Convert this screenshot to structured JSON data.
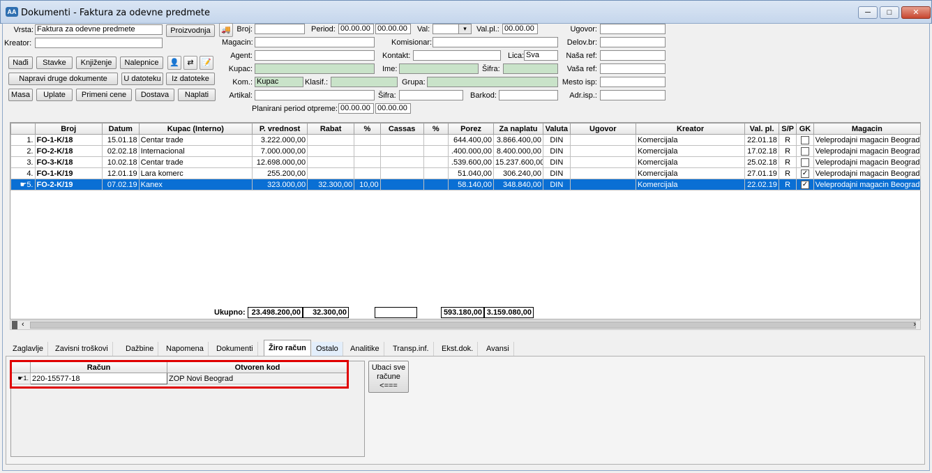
{
  "window": {
    "title": "Dokumenti - Faktura za odevne predmete",
    "icon": "app-icon",
    "min": "─",
    "max": "□",
    "close": "✕"
  },
  "form": {
    "vrsta_label": "Vrsta:",
    "vrsta": "Faktura za odevne predmete",
    "proizvodnja": "Proizvodnja",
    "kreator_label": "Kreator:",
    "kreator": "",
    "broj_label": "Broj:",
    "broj": "",
    "period_label": "Period:",
    "period_from": "00.00.00",
    "period_to": "00.00.00",
    "val_label": "Val:",
    "val": "",
    "valpl_label": "Val.pl.:",
    "valpl": "00.00.00",
    "ugovor_label": "Ugovor:",
    "ugovor": "",
    "magacin_label": "Magacin:",
    "magacin": "",
    "komisionar_label": "Komisionar:",
    "komisionar": "",
    "delovbr_label": "Delov.br:",
    "delovbr": "",
    "agent_label": "Agent:",
    "agent": "",
    "kontakt_label": "Kontakt:",
    "kontakt": "",
    "lica_label": "Lica:",
    "lica": "Sva",
    "nasaref_label": "Naša ref:",
    "nasaref": "",
    "kupac_label": "Kupac:",
    "kupac": "",
    "ime_label": "Ime:",
    "ime": "",
    "sifra_label": "Šifra:",
    "sifra": "",
    "vasaref_label": "Vaša ref:",
    "vasaref": "",
    "kom_label": "Kom.:",
    "kom": "Kupac",
    "klasif_label": "Klasif.:",
    "klasif": "",
    "grupa_label": "Grupa:",
    "grupa": "",
    "mestoisp_label": "Mesto isp:",
    "mestoisp": "",
    "artikal_label": "Artikal:",
    "artikal": "",
    "sifra2_label": "Šifra:",
    "sifra2": "",
    "barkod_label": "Barkod:",
    "barkod": "",
    "adrisp_label": "Adr.isp.:",
    "adrisp": "",
    "planirani_label": "Planirani period otpreme:",
    "plan_from": "00.00.00",
    "plan_to": "00.00.00"
  },
  "buttons": {
    "nadji": "Nađi",
    "stavke": "Stavke",
    "knjizenje": "Knjiženje",
    "nalepnice": "Nalepnice",
    "napravi": "Napravi druge dokumente",
    "u_datoteku": "U datoteku",
    "iz_datoteke": "Iz datoteke",
    "masa": "Masa",
    "uplate": "Uplate",
    "primeni_cene": "Primeni cene",
    "dostava": "Dostava",
    "naplati": "Naplati"
  },
  "grid": {
    "columns": [
      "Broj",
      "Datum",
      "Kupac (Interno)",
      "P. vrednost",
      "Rabat",
      "%",
      "Cassas",
      "%",
      "Porez",
      "Za naplatu",
      "Valuta",
      "Ugovor",
      "Kreator",
      "Val. pl.",
      "S/P",
      "GK",
      "Magacin"
    ],
    "rows": [
      {
        "n": "1.",
        "broj": "FO-1-K/18",
        "datum": "15.01.18",
        "kupac": "Centar trade",
        "pvr": "3.222.000,00",
        "rabat": "",
        "pct": "",
        "cassas": "",
        "pct2": "",
        "porez": "644.400,00",
        "zanapl": "3.866.400,00",
        "valuta": "DIN",
        "ugovor": "",
        "kreator": "Komercijala",
        "valpl": "22.01.18",
        "sp": "R",
        "gk": "",
        "magacin": "Veleprodajni magacin Beograd"
      },
      {
        "n": "2.",
        "broj": "FO-2-K/18",
        "datum": "02.02.18",
        "kupac": "Internacional",
        "pvr": "7.000.000,00",
        "rabat": "",
        "pct": "",
        "cassas": "",
        "pct2": "",
        "porez": ".400.000,00",
        "zanapl": "8.400.000,00",
        "valuta": "DIN",
        "ugovor": "",
        "kreator": "Komercijala",
        "valpl": "17.02.18",
        "sp": "R",
        "gk": "",
        "magacin": "Veleprodajni magacin Beograd"
      },
      {
        "n": "3.",
        "broj": "FO-3-K/18",
        "datum": "10.02.18",
        "kupac": "Centar trade",
        "pvr": "12.698.000,00",
        "rabat": "",
        "pct": "",
        "cassas": "",
        "pct2": "",
        "porez": ".539.600,00",
        "zanapl": "15.237.600,00",
        "valuta": "DIN",
        "ugovor": "",
        "kreator": "Komercijala",
        "valpl": "25.02.18",
        "sp": "R",
        "gk": "",
        "magacin": "Veleprodajni magacin Beograd"
      },
      {
        "n": "4.",
        "broj": "FO-1-K/19",
        "datum": "12.01.19",
        "kupac": "Lara komerc",
        "pvr": "255.200,00",
        "rabat": "",
        "pct": "",
        "cassas": "",
        "pct2": "",
        "porez": "51.040,00",
        "zanapl": "306.240,00",
        "valuta": "DIN",
        "ugovor": "",
        "kreator": "Komercijala",
        "valpl": "27.01.19",
        "sp": "R",
        "gk": "✓",
        "magacin": "Veleprodajni magacin Beograd"
      },
      {
        "n": "5.",
        "broj": "FO-2-K/19",
        "datum": "07.02.19",
        "kupac": "Kanex",
        "pvr": "323.000,00",
        "rabat": "32.300,00",
        "pct": "10,00",
        "cassas": "",
        "pct2": "",
        "porez": "58.140,00",
        "zanapl": "348.840,00",
        "valuta": "DIN",
        "ugovor": "",
        "kreator": "Komercijala",
        "valpl": "22.02.19",
        "sp": "R",
        "gk": "✓",
        "magacin": "Veleprodajni magacin Beograd"
      }
    ],
    "ukupno_label": "Ukupno:",
    "tot_pvr": "23.498.200,00",
    "tot_rabat": "32.300,00",
    "tot_cassas": "",
    "tot_porez": "593.180,00",
    "tot_zanapl": "3.159.080,00"
  },
  "tabs": [
    "Zaglavlje",
    "Zavisni troškovi",
    "Dažbine",
    "Napomena",
    "Dokumenti",
    "Žiro račun",
    "Ostalo",
    "Analitike",
    "Transp.inf.",
    "Ekst.dok.",
    "Avansi"
  ],
  "accounts": {
    "col_racun": "Račun",
    "col_kod": "Otvoren kod",
    "rows": [
      {
        "n": "1.",
        "racun": "220-15577-18",
        "kod": "ZOP Novi Beograd"
      }
    ]
  },
  "ubaci_button": "Ubaci sve račune <==="
}
